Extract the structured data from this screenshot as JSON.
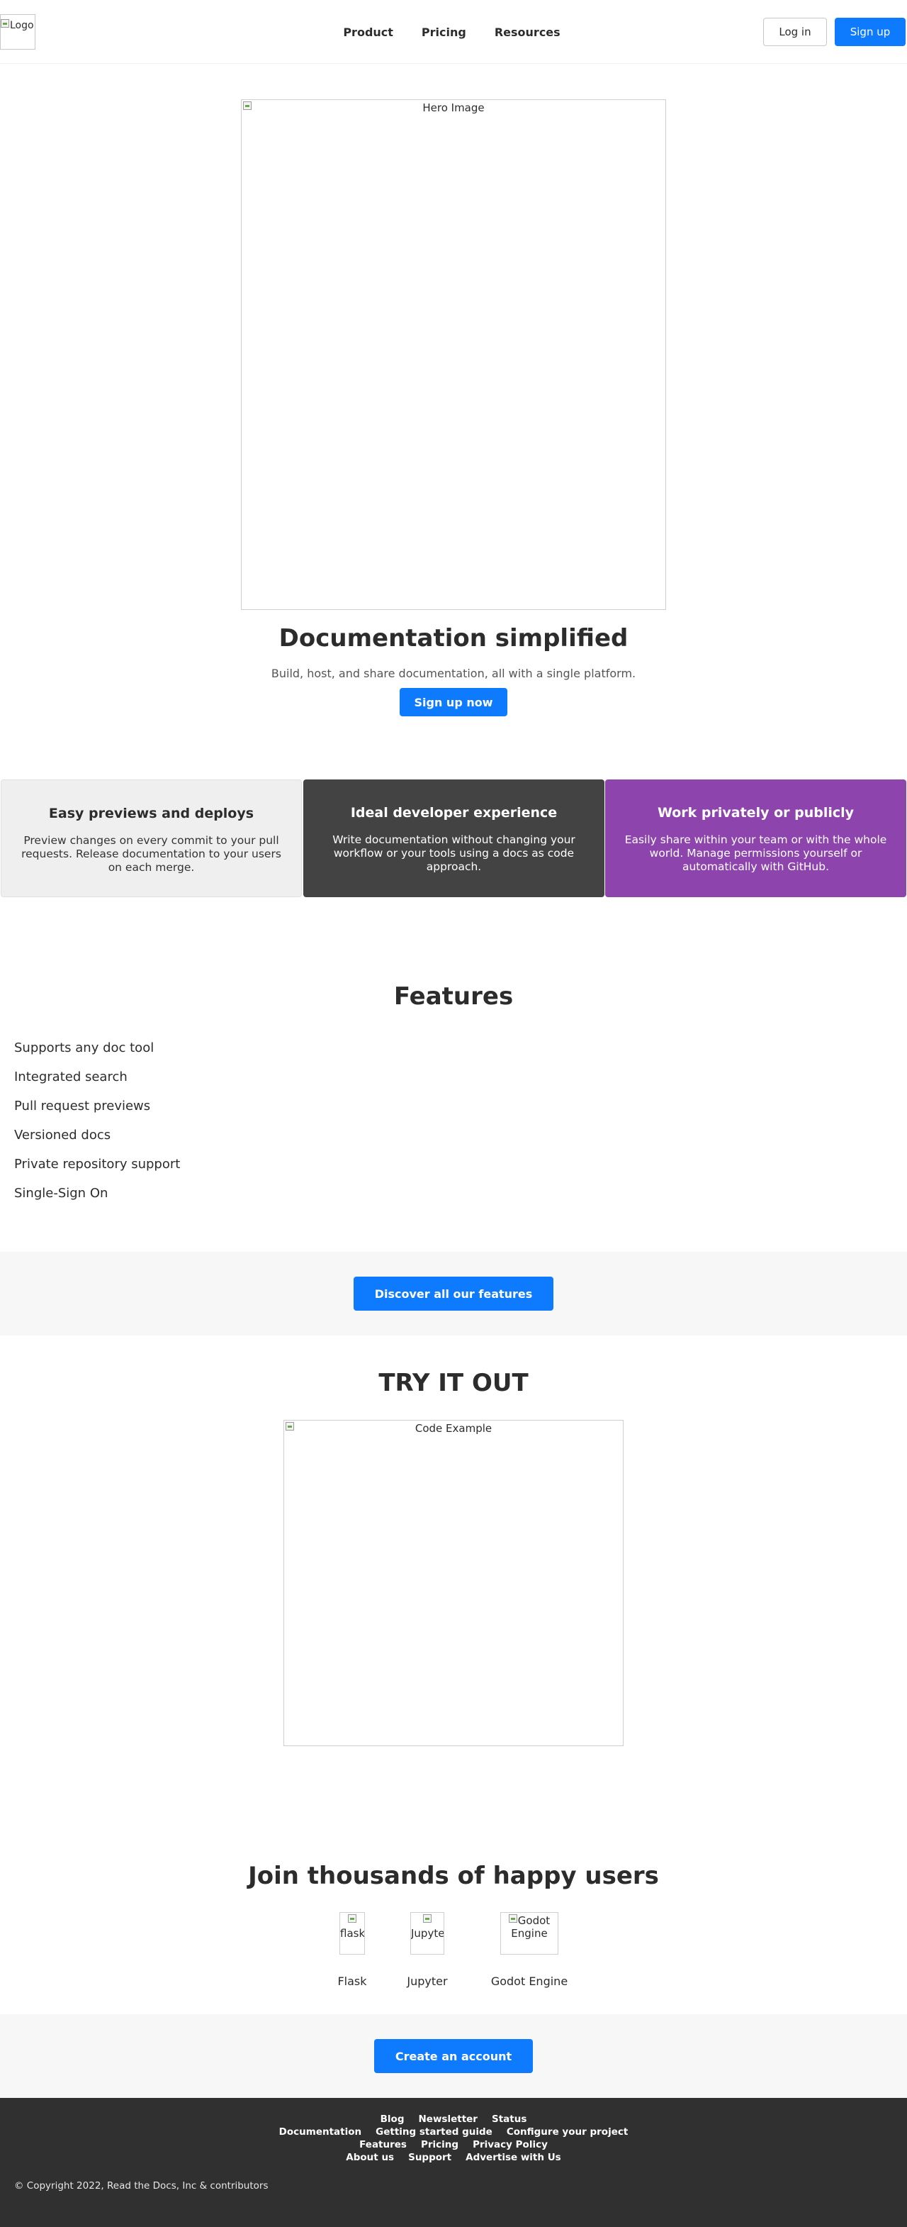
{
  "header": {
    "logo_alt": "Logo",
    "nav": [
      "Product",
      "Pricing",
      "Resources"
    ],
    "login_label": "Log in",
    "signup_label": "Sign up"
  },
  "hero": {
    "image_alt": "Hero Image",
    "title": "Documentation simplified",
    "subtitle": "Build, host, and share documentation, all with a single platform.",
    "cta_label": "Sign up now"
  },
  "cards": [
    {
      "title": "Easy previews and deploys",
      "text": "Preview changes on every commit to your pull requests. Release documentation to your users on each merge.",
      "color": "#efefef"
    },
    {
      "title": "Ideal developer experience",
      "text": "Write documentation without changing your workflow or your tools using a docs as code approach.",
      "color": "#434343"
    },
    {
      "title": "Work privately or publicly",
      "text": "Easily share within your team or with the whole world. Manage permissions yourself or automatically with GitHub.",
      "color": "#8e44ad"
    }
  ],
  "features": {
    "title": "Features",
    "items": [
      "Supports any doc tool",
      "Integrated search",
      "Pull request previews",
      "Versioned docs",
      "Private repository support",
      "Single-Sign On"
    ],
    "cta_label": "Discover all our features"
  },
  "try": {
    "title": "TRY IT OUT",
    "image_alt": "Code Example"
  },
  "users": {
    "title": "Join thousands of happy users",
    "logos": [
      {
        "alt": "flask",
        "name": "Flask"
      },
      {
        "alt": "Jupyter",
        "name": "Jupyter"
      },
      {
        "alt": "Godot Engine",
        "name": "Godot Engine"
      }
    ],
    "cta_label": "Create an account"
  },
  "footer": {
    "row1": [
      "Blog",
      "Newsletter",
      "Status"
    ],
    "row2": [
      "Documentation",
      "Getting started guide",
      "Configure your project"
    ],
    "row3": [
      "Features",
      "Pricing",
      "Privacy Policy"
    ],
    "row4": [
      "About us",
      "Support",
      "Advertise with Us"
    ],
    "copyright": "© Copyright 2022, Read the Docs, Inc & contributors"
  },
  "colors": {
    "accent": "#0e7bff",
    "dark_card": "#434343",
    "purple_card": "#8e44ad",
    "footer_bg": "#303030"
  }
}
